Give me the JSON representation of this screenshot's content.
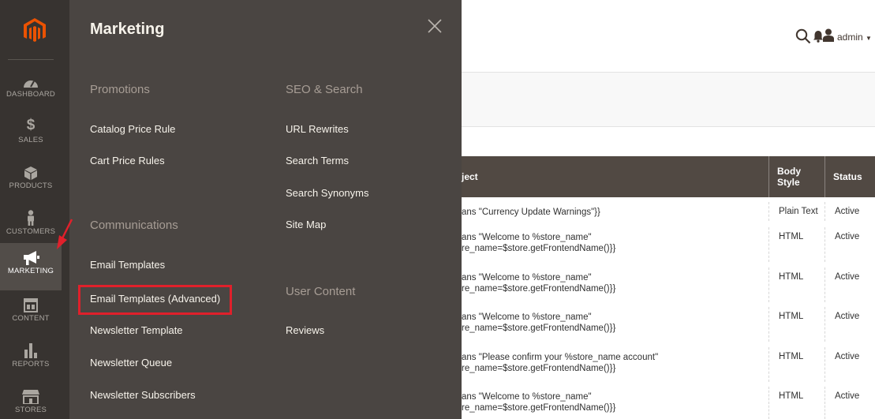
{
  "nav": {
    "items": [
      {
        "label": "DASHBOARD",
        "icon": "dashboard-icon"
      },
      {
        "label": "SALES",
        "icon": "dollar-icon"
      },
      {
        "label": "PRODUCTS",
        "icon": "cube-icon"
      },
      {
        "label": "CUSTOMERS",
        "icon": "person-icon"
      },
      {
        "label": "MARKETING",
        "icon": "megaphone-icon"
      },
      {
        "label": "CONTENT",
        "icon": "layout-icon"
      },
      {
        "label": "REPORTS",
        "icon": "bar-chart-icon"
      },
      {
        "label": "STORES",
        "icon": "store-icon"
      }
    ],
    "active": "MARKETING"
  },
  "flyout": {
    "title": "Marketing",
    "groups": {
      "promotions": {
        "title": "Promotions",
        "items": [
          "Catalog Price Rule",
          "Cart Price Rules"
        ]
      },
      "communications": {
        "title": "Communications",
        "items": [
          "Email Templates",
          "Email Templates (Advanced)",
          "Newsletter Template",
          "Newsletter Queue",
          "Newsletter Subscribers"
        ]
      },
      "seo": {
        "title": "SEO & Search",
        "items": [
          "URL Rewrites",
          "Search Terms",
          "Search Synonyms",
          "Site Map"
        ]
      },
      "user_content": {
        "title": "User Content",
        "items": [
          "Reviews"
        ]
      }
    }
  },
  "header": {
    "user": "admin"
  },
  "grid": {
    "columns": [
      "ject",
      "Body\nStyle",
      "Status"
    ],
    "rows": [
      {
        "subject": [
          "ans \"Currency Update Warnings\"}}"
        ],
        "body": "Plain Text",
        "status": "Active"
      },
      {
        "subject": [
          "ans \"Welcome to %store_name\"",
          "re_name=$store.getFrontendName()}}"
        ],
        "body": "HTML",
        "status": "Active"
      },
      {
        "subject": [
          "ans \"Welcome to %store_name\"",
          "re_name=$store.getFrontendName()}}"
        ],
        "body": "HTML",
        "status": "Active"
      },
      {
        "subject": [
          "ans \"Welcome to %store_name\"",
          "re_name=$store.getFrontendName()}}"
        ],
        "body": "HTML",
        "status": "Active"
      },
      {
        "subject": [
          "ans \"Please confirm your %store_name account\"",
          "re_name=$store.getFrontendName()}}"
        ],
        "body": "HTML",
        "status": "Active"
      },
      {
        "subject": [
          "ans \"Welcome to %store_name\"",
          "re_name=$store.getFrontendName()}}"
        ],
        "body": "HTML",
        "status": "Active"
      }
    ]
  },
  "colors": {
    "nav_bg": "#373330",
    "flyout_bg": "#4a4542",
    "grid_head_bg": "#514943",
    "brand_orange": "#eb5202",
    "highlight_red": "#e0202b"
  }
}
